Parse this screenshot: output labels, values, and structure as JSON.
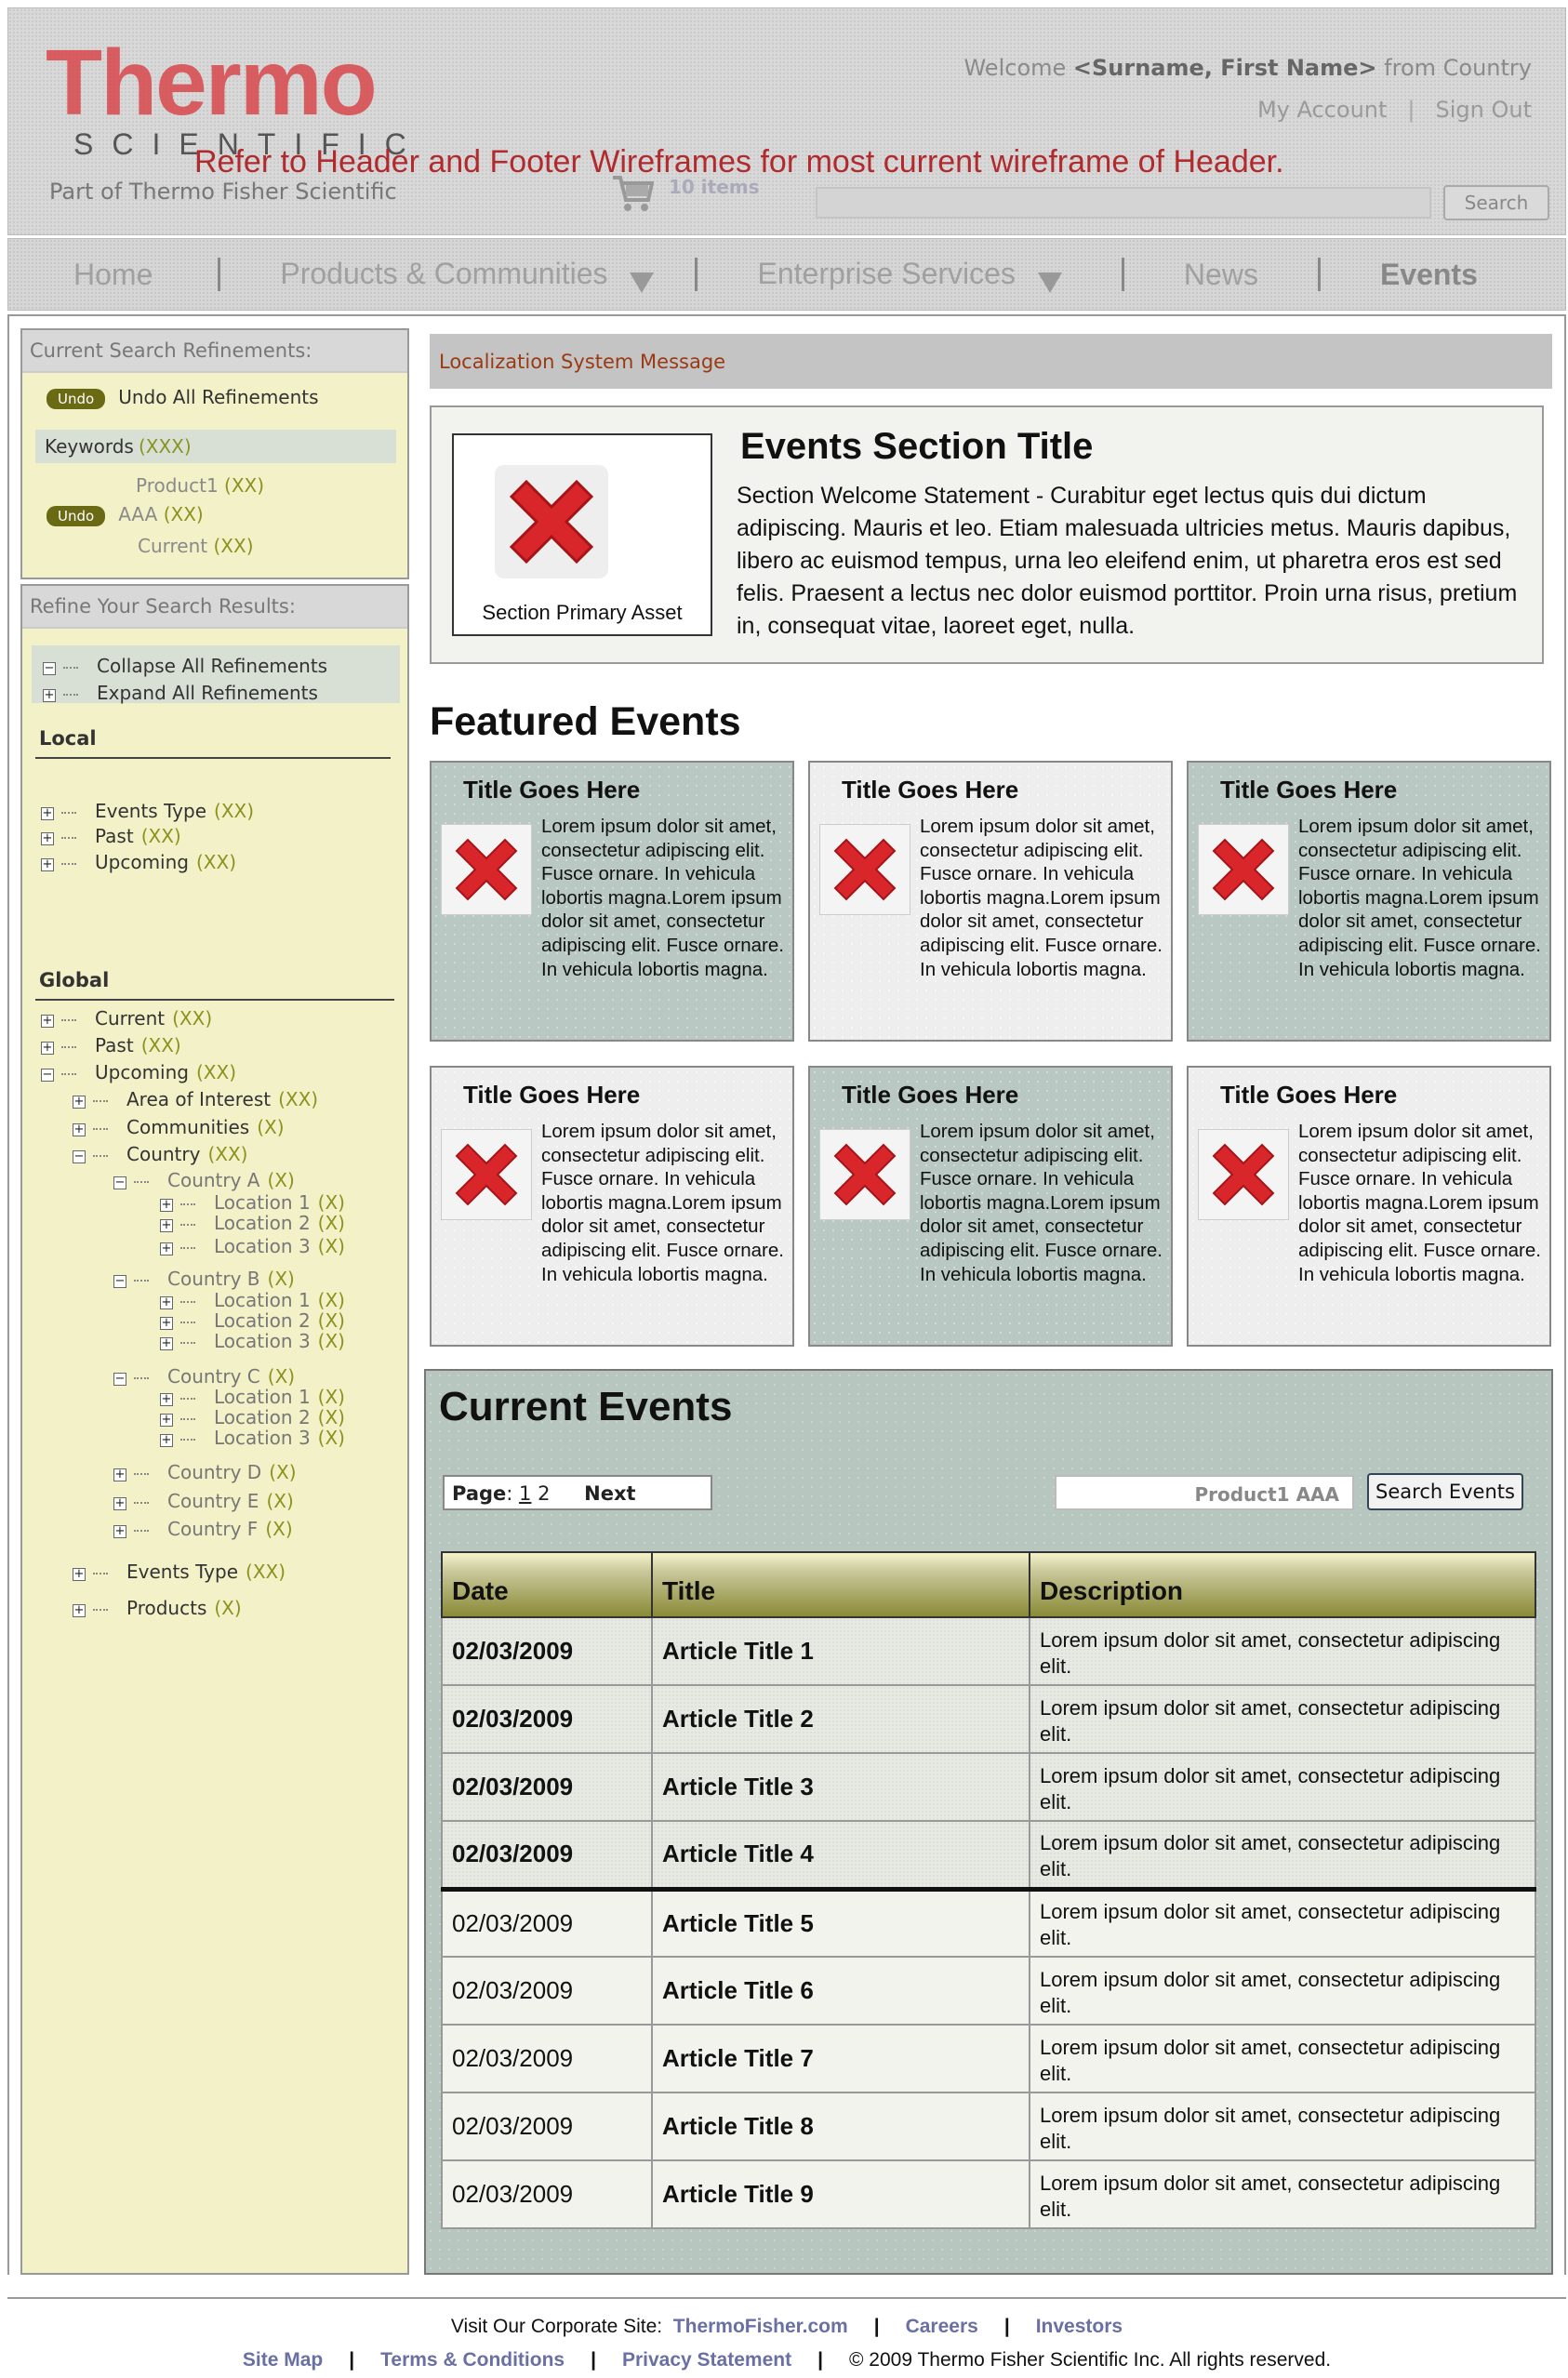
{
  "header": {
    "logo_main": "Thermo",
    "logo_sub": "SCIENTIFIC",
    "logo_tagline": "Part of Thermo Fisher Scientific",
    "wireframe_note": "Refer to Header and Footer Wireframes for most current wireframe of Header.",
    "welcome_prefix": "Welcome",
    "welcome_name": "<Surname, First Name>",
    "welcome_from": "from",
    "welcome_country": "Country",
    "my_account": "My Account",
    "account_sep": "|",
    "sign_out": "Sign Out",
    "cart_count": "10 items",
    "search_value": "",
    "search_button": "Search"
  },
  "nav": {
    "items": [
      "Home",
      "Products & Communities",
      "Enterprise Services",
      "News",
      "Events"
    ],
    "sep": "|"
  },
  "sidebar": {
    "current_refinements_title": "Current Search Refinements:",
    "undo_label": "Undo",
    "undo_all": "Undo All Refinements",
    "keywords_label": "Keywords",
    "keywords_count": "(XXX)",
    "refinements": [
      {
        "label": "Product1",
        "count": "(XX)"
      },
      {
        "label": "AAA",
        "count": "(XX)"
      },
      {
        "label": "Current",
        "count": "(XX)"
      }
    ],
    "refine_title": "Refine Your Search Results:",
    "collapse_all": "Collapse All Refinements",
    "expand_all": "Expand All Refinements",
    "local_title": "Local",
    "local_items": [
      {
        "label": "Events Type",
        "count": "(XX)"
      },
      {
        "label": "Past",
        "count": "(XX)"
      },
      {
        "label": "Upcoming",
        "count": "(XX)"
      }
    ],
    "global_title": "Global",
    "global_items": [
      {
        "label": "Current",
        "count": "(XX)"
      },
      {
        "label": "Past",
        "count": "(XX)"
      },
      {
        "label": "Upcoming",
        "count": "(XX)"
      },
      {
        "label": "Area of Interest",
        "count": "(XX)"
      },
      {
        "label": "Communities",
        "count": "(X)"
      },
      {
        "label": "Country",
        "count": "(XX)"
      },
      {
        "label": "Country A",
        "count": "(X)"
      },
      {
        "label": "Location 1",
        "count": "(X)"
      },
      {
        "label": "Location 2",
        "count": "(X)"
      },
      {
        "label": "Location 3",
        "count": "(X)"
      },
      {
        "label": "Country B",
        "count": "(X)"
      },
      {
        "label": "Location 1",
        "count": "(X)"
      },
      {
        "label": "Location 2",
        "count": "(X)"
      },
      {
        "label": "Location 3",
        "count": "(X)"
      },
      {
        "label": "Country C",
        "count": "(X)"
      },
      {
        "label": "Location 1",
        "count": "(X)"
      },
      {
        "label": "Location 2",
        "count": "(X)"
      },
      {
        "label": "Location 3",
        "count": "(X)"
      },
      {
        "label": "Country D",
        "count": "(X)"
      },
      {
        "label": "Country E",
        "count": "(X)"
      },
      {
        "label": "Country F",
        "count": "(X)"
      },
      {
        "label": "Events Type",
        "count": "(XX)"
      },
      {
        "label": "Products",
        "count": "(X)"
      }
    ]
  },
  "main": {
    "localization_message": "Localization System Message",
    "hero_asset_caption": "Section Primary Asset",
    "hero_title": "Events Section Title",
    "hero_body": "Section Welcome Statement - Curabitur eget lectus quis dui dictum adipiscing. Mauris et leo. Etiam malesuada ultricies metus. Mauris dapibus, libero ac euismod tempus, urna leo eleifend enim, ut pharetra eros est sed felis. Praesent a lectus nec dolor euismod porttitor. Proin urna risus, pretium in, consequat vitae, laoreet eget, nulla.",
    "featured_title": "Featured Events",
    "cards": [
      {
        "title": "Title Goes Here",
        "body": "Lorem ipsum dolor sit amet, consectetur adipiscing elit. Fusce ornare. In vehicula lobortis magna.Lorem ipsum dolor sit amet, consectetur adipiscing elit. Fusce ornare. In vehicula lobortis magna."
      },
      {
        "title": "Title Goes Here",
        "body": "Lorem ipsum dolor sit amet, consectetur adipiscing elit. Fusce ornare. In vehicula lobortis magna.Lorem ipsum dolor sit amet, consectetur adipiscing elit. Fusce ornare. In vehicula lobortis magna."
      },
      {
        "title": "Title Goes Here",
        "body": "Lorem ipsum dolor sit amet, consectetur adipiscing elit. Fusce ornare. In vehicula lobortis magna.Lorem ipsum dolor sit amet, consectetur adipiscing elit. Fusce ornare. In vehicula lobortis magna."
      },
      {
        "title": "Title Goes Here",
        "body": "Lorem ipsum dolor sit amet, consectetur adipiscing elit. Fusce ornare. In vehicula lobortis magna.Lorem ipsum dolor sit amet, consectetur adipiscing elit. Fusce ornare. In vehicula lobortis magna."
      },
      {
        "title": "Title Goes Here",
        "body": "Lorem ipsum dolor sit amet, consectetur adipiscing elit. Fusce ornare. In vehicula lobortis magna.Lorem ipsum dolor sit amet, consectetur adipiscing elit. Fusce ornare. In vehicula lobortis magna."
      },
      {
        "title": "Title Goes Here",
        "body": "Lorem ipsum dolor sit amet, consectetur adipiscing elit. Fusce ornare. In vehicula lobortis magna.Lorem ipsum dolor sit amet, consectetur adipiscing elit. Fusce ornare. In vehicula lobortis magna."
      }
    ],
    "current_events_title": "Current Events",
    "pager_label": "Page",
    "pager_colon": ":",
    "pager_page1": "1",
    "pager_page2": "2",
    "pager_next": "Next",
    "events_search_value": "Product1 AAA",
    "events_search_button": "Search Events",
    "table_headers": [
      "Date",
      "Title",
      "Description"
    ],
    "rows": [
      {
        "date": "02/03/2009",
        "title": "Article Title 1",
        "desc": "Lorem ipsum dolor sit amet, consectetur adipiscing elit."
      },
      {
        "date": "02/03/2009",
        "title": "Article Title 2",
        "desc": "Lorem ipsum dolor sit amet, consectetur adipiscing elit."
      },
      {
        "date": "02/03/2009",
        "title": "Article Title 3",
        "desc": "Lorem ipsum dolor sit amet, consectetur adipiscing elit."
      },
      {
        "date": "02/03/2009",
        "title": "Article Title 4",
        "desc": "Lorem ipsum dolor sit amet, consectetur adipiscing elit."
      },
      {
        "date": "02/03/2009",
        "title": "Article Title 5",
        "desc": "Lorem ipsum dolor sit amet, consectetur adipiscing elit."
      },
      {
        "date": "02/03/2009",
        "title": "Article Title 6",
        "desc": "Lorem ipsum dolor sit amet, consectetur adipiscing elit."
      },
      {
        "date": "02/03/2009",
        "title": "Article Title 7",
        "desc": "Lorem ipsum dolor sit amet, consectetur adipiscing elit."
      },
      {
        "date": "02/03/2009",
        "title": "Article Title 8",
        "desc": "Lorem ipsum dolor sit amet, consectetur adipiscing elit."
      },
      {
        "date": "02/03/2009",
        "title": "Article Title 9",
        "desc": "Lorem ipsum dolor sit amet, consectetur adipiscing elit."
      }
    ]
  },
  "footer": {
    "corporate_prefix": "Visit Our Corporate Site:",
    "corporate_link": "ThermoFisher.com",
    "careers": "Careers",
    "investors": "Investors",
    "site_map": "Site Map",
    "terms": "Terms & Conditions",
    "privacy": "Privacy Statement",
    "copyright": "© 2009 Thermo Fisher Scientific Inc. All rights reserved.",
    "sep": "|"
  },
  "colors": {
    "logo_red": "#d9484c",
    "note_red": "#b02a2e",
    "sidebar_bg": "#f3f1c7",
    "teal": "#b9c8c2",
    "link": "#6a6fa4",
    "count_green": "#8a9320"
  },
  "icons": [
    "cart-icon",
    "broken-image-icon",
    "expand-icon",
    "collapse-icon"
  ]
}
